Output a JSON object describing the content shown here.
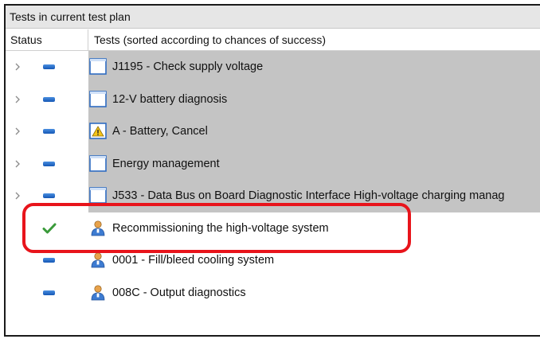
{
  "panel": {
    "title": "Tests in current test plan",
    "columns": {
      "status": "Status",
      "tests": "Tests (sorted according to chances of success)"
    }
  },
  "rows": [
    {
      "expander": true,
      "status": "pending",
      "icon": "document-icon",
      "label": "J1195 -  Check supply voltage"
    },
    {
      "expander": true,
      "status": "pending",
      "icon": "document-icon",
      "label": "12-V battery diagnosis"
    },
    {
      "expander": true,
      "status": "pending",
      "icon": "warning-document-icon",
      "label": "A - Battery, Cancel"
    },
    {
      "expander": true,
      "status": "pending",
      "icon": "document-icon",
      "label": "Energy management"
    },
    {
      "expander": true,
      "status": "pending",
      "icon": "document-icon",
      "label": "J533 - Data Bus on Board Diagnostic Interface  High-voltage charging manag"
    },
    {
      "expander": false,
      "status": "completed",
      "icon": "user-icon",
      "label": "Recommissioning the high-voltage system"
    },
    {
      "expander": false,
      "status": "pending",
      "icon": "user-icon",
      "label": "0001 - Fill/bleed cooling system"
    },
    {
      "expander": false,
      "status": "pending",
      "icon": "user-icon",
      "label": "008C - Output diagnostics"
    }
  ],
  "highlighted_row": "Recommissioning the high-voltage system",
  "colors": {
    "highlight_border": "#e8141b",
    "group_background": "#c4c4c4",
    "status_pending": "#1f66c8",
    "status_completed": "#3a9a3a"
  }
}
